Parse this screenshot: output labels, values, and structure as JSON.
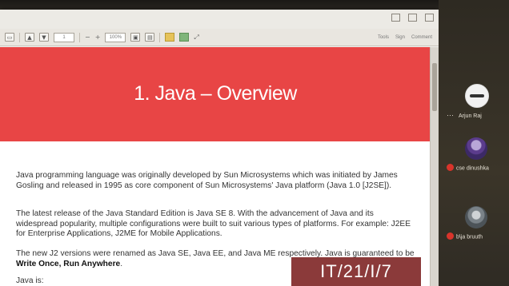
{
  "document": {
    "chapter_title": "1. Java – Overview",
    "paragraphs": [
      {
        "text": "Java programming language was originally developed by Sun Microsystems which was initiated by James Gosling and released in 1995 as core component of Sun Microsystems' Java platform (Java 1.0 [J2SE])."
      },
      {
        "text": "The latest release of the Java Standard Edition is Java SE 8. With the advancement of Java and its widespread popularity, multiple configurations were built to suit various types of platforms. For example: J2EE for Enterprise Applications, J2ME for Mobile Applications."
      },
      {
        "text_before": "The new J2 versions were renamed as Java SE, Java EE, and Java ME respectively. Java is guaranteed to be ",
        "bold": "Write Once, Run Anywhere",
        "text_after": "."
      },
      {
        "text": "Java is:"
      }
    ]
  },
  "watermark": "IT/21/I/7",
  "participants": [
    {
      "name": "Arjun Raj",
      "muted": false,
      "more": "···"
    },
    {
      "name": "cse dinushka",
      "muted": true
    },
    {
      "name": "b\\ja bruuth",
      "muted": true
    }
  ],
  "toolbar": {
    "page_box": "1",
    "zoom_box": "100%",
    "right_tabs": [
      "Tools",
      "Sign",
      "Comment"
    ]
  }
}
